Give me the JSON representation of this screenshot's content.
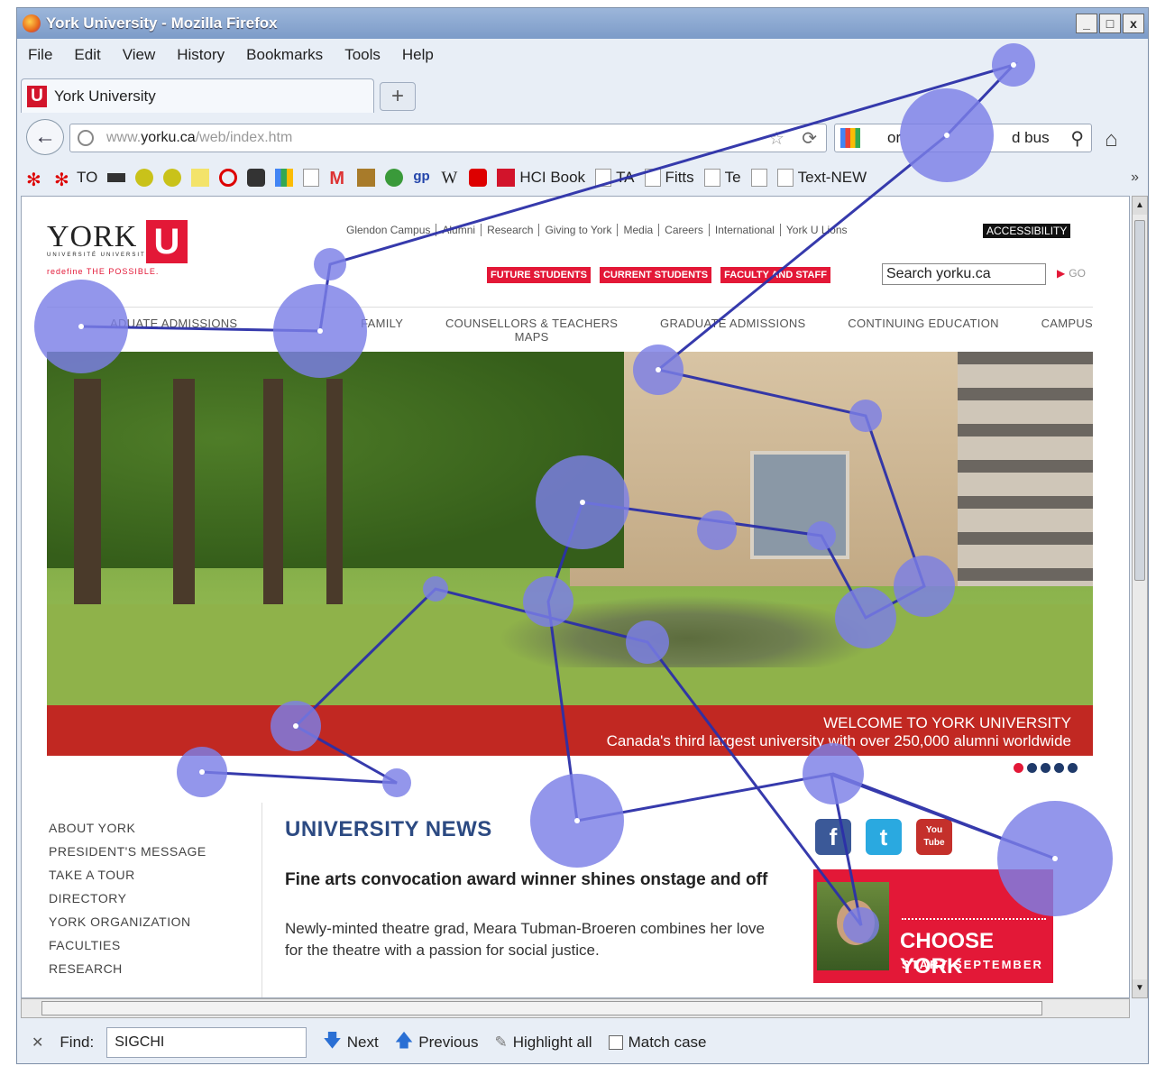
{
  "window": {
    "title": "York University - Mozilla Firefox",
    "controls": [
      "_",
      "□",
      "x"
    ]
  },
  "menu": [
    "File",
    "Edit",
    "View",
    "History",
    "Bookmarks",
    "Tools",
    "Help"
  ],
  "tab": {
    "label": "York University",
    "new_tab": "+"
  },
  "nav": {
    "url_prefix": "www.",
    "url_domain": "yorku.ca",
    "url_path": "/web/index.htm",
    "search_fragments": [
      "or",
      "d bus"
    ]
  },
  "bookmarks": [
    "TO",
    "HCI Book",
    "TA",
    "Fitts",
    "Te",
    "Text-NEW"
  ],
  "site": {
    "logo_word": "YORK",
    "logo_sub": "UNIVERSITÉ UNIVERSITY",
    "logo_tag": "redefine THE POSSIBLE.",
    "top_links": [
      "Glendon Campus",
      "Alumni",
      "Research",
      "Giving to York",
      "Media",
      "Careers",
      "International",
      "York U Lions"
    ],
    "accessibility": "ACCESSIBILITY",
    "audience": [
      "FUTURE STUDENTS",
      "CURRENT STUDENTS",
      "FACULTY AND STAFF"
    ],
    "search_placeholder": "Search yorku.ca",
    "go": "GO",
    "nav": [
      "ADUATE ADMISSIONS",
      "FAMILY",
      "COUNSELLORS & TEACHERS",
      "GRADUATE ADMISSIONS",
      "CONTINUING EDUCATION",
      "CAMPUS"
    ],
    "nav_sub": "MAPS",
    "banner_title": "WELCOME TO YORK UNIVERSITY",
    "banner_sub": "Canada's third largest university with over 250,000 alumni worldwide",
    "side_menu": [
      "ABOUT YORK",
      "PRESIDENT'S MESSAGE",
      "TAKE A TOUR",
      "DIRECTORY",
      "YORK ORGANIZATION",
      "FACULTIES",
      "RESEARCH"
    ],
    "news_heading": "UNIVERSITY NEWS",
    "news_title": "Fine arts convocation award winner shines onstage and off",
    "news_body": "Newly-minted theatre grad, Meara Tubman-Broeren combines her love for the theatre with a passion for social justice.",
    "social": [
      "f",
      "t",
      "You Tube"
    ],
    "promo_title": "CHOOSE YORK",
    "promo_sub": "START SEPTEMBER"
  },
  "find": {
    "label": "Find:",
    "value": "SIGCHI",
    "next": "Next",
    "previous": "Previous",
    "highlight": "Highlight all",
    "match_case": "Match case"
  },
  "colors": {
    "york_red": "#e31837",
    "gaze_fill": "#7b7fe6",
    "gaze_line": "#2b2fa8",
    "news_blue": "#2c4a82"
  }
}
